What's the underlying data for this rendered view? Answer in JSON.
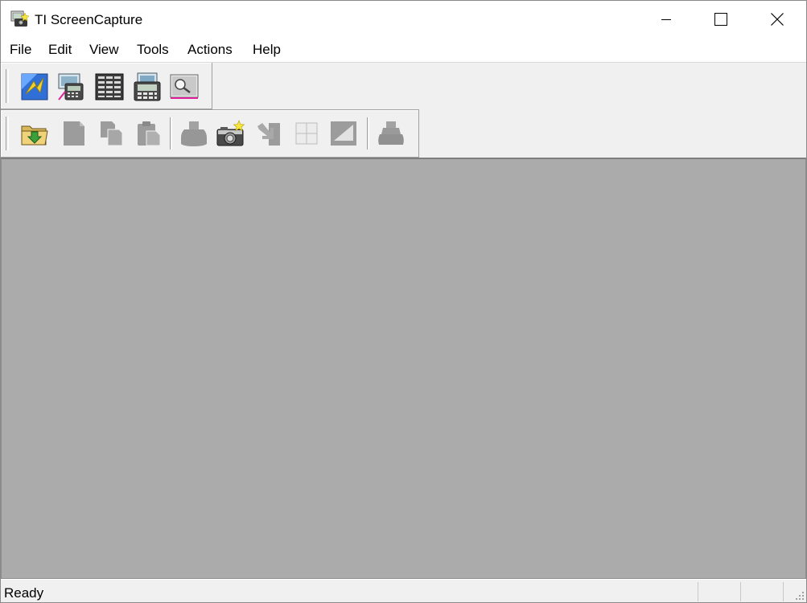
{
  "window": {
    "title": "TI ScreenCapture",
    "controls": [
      "minimize-icon",
      "maximize-icon",
      "close-icon"
    ]
  },
  "menu": {
    "items": [
      "File",
      "Edit",
      "View",
      "Tools",
      "Actions",
      "Help"
    ]
  },
  "toolbar_top": {
    "buttons": [
      {
        "icon": "calculator-emulator-icon",
        "enabled": true
      },
      {
        "icon": "calculator-zoom-icon",
        "enabled": true
      },
      {
        "icon": "keypad-grid-icon",
        "enabled": true
      },
      {
        "icon": "handheld-device-icon",
        "enabled": true
      },
      {
        "icon": "screen-search-icon",
        "enabled": true
      }
    ]
  },
  "toolbar_bottom": {
    "buttons": [
      {
        "icon": "open-folder-icon",
        "enabled": true
      },
      {
        "icon": "page-icon",
        "enabled": false
      },
      {
        "icon": "copy-icon",
        "enabled": false
      },
      {
        "icon": "paste-icon",
        "enabled": false
      },
      {
        "icon": "capture-device-icon",
        "enabled": false
      },
      {
        "icon": "camera-icon",
        "enabled": true
      },
      {
        "icon": "send-icon",
        "enabled": false
      },
      {
        "icon": "grid-icon",
        "enabled": false
      },
      {
        "icon": "frame-icon",
        "enabled": false
      },
      {
        "icon": "stack-device-icon",
        "enabled": false
      }
    ]
  },
  "status": {
    "text": "Ready"
  },
  "colors": {
    "workspace": "#ababab",
    "chrome": "#f0f0f0",
    "titlebar": "#ffffff"
  }
}
